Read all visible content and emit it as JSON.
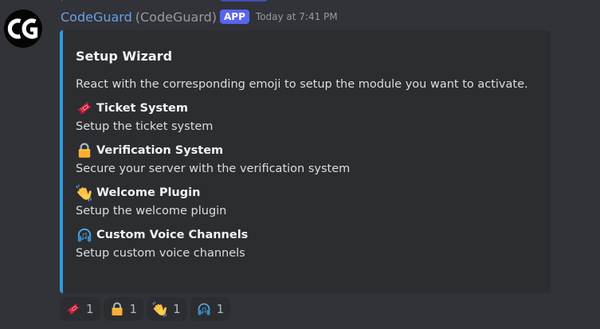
{
  "message": {
    "author": {
      "display_name": "CodeGuard",
      "username_paren": "(CodeGuard)",
      "badge": "APP",
      "avatar_text": "CG"
    },
    "timestamp": "Today at 7:41 PM",
    "embed": {
      "accent_color": "#3498db",
      "title": "Setup Wizard",
      "description": "React with the corresponding emoji to setup the module you want to activate.",
      "fields": [
        {
          "emoji": "ticket-icon",
          "name": "Ticket System",
          "value": "Setup the ticket system"
        },
        {
          "emoji": "lock-icon",
          "name": "Verification System",
          "value": "Secure your server with the verification system"
        },
        {
          "emoji": "waving-hand-icon",
          "name": "Welcome Plugin",
          "value": "Setup the welcome plugin"
        },
        {
          "emoji": "headphones-icon",
          "name": "Custom Voice Channels",
          "value": "Setup custom voice channels"
        }
      ]
    },
    "reactions": [
      {
        "emoji": "ticket-icon",
        "count": "1"
      },
      {
        "emoji": "lock-icon",
        "count": "1"
      },
      {
        "emoji": "waving-hand-icon",
        "count": "1"
      },
      {
        "emoji": "headphones-icon",
        "count": "1"
      }
    ]
  },
  "colors": {
    "background": "#313338",
    "embed_background": "#2b2d31",
    "username": "#6ba0e6",
    "badge": "#5865f2",
    "muted": "#949ba4"
  }
}
